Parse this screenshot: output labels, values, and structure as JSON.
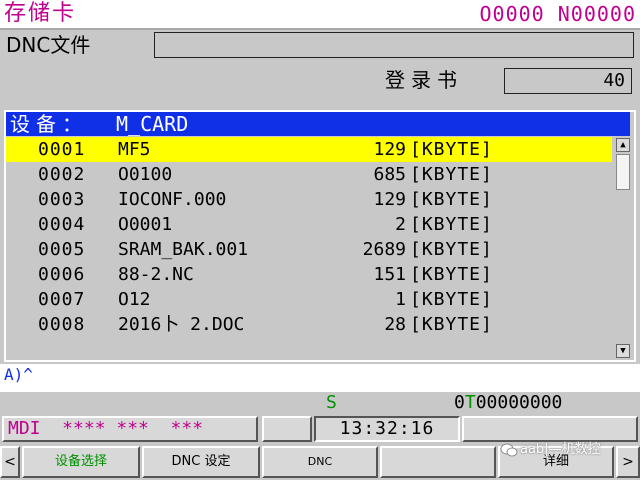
{
  "header": {
    "title": "存储卡",
    "program": "O0000 N00000"
  },
  "dnc": {
    "label": "DNC文件",
    "value": ""
  },
  "login": {
    "label": "登录书",
    "value": "40"
  },
  "list": {
    "device_label": "设备：",
    "device_value": "M_CARD",
    "rows": [
      {
        "no": "0001",
        "name": "MF5",
        "size": "129",
        "unit": "[KBYTE]",
        "selected": true
      },
      {
        "no": "0002",
        "name": "O0100",
        "size": "685",
        "unit": "[KBYTE]"
      },
      {
        "no": "0003",
        "name": "IOCONF.000",
        "size": "129",
        "unit": "[KBYTE]"
      },
      {
        "no": "0004",
        "name": "O0001",
        "size": "2",
        "unit": "[KBYTE]"
      },
      {
        "no": "0005",
        "name": "SRAM_BAK.001",
        "size": "2689",
        "unit": "[KBYTE]"
      },
      {
        "no": "0006",
        "name": "88-2.NC",
        "size": "151",
        "unit": "[KBYTE]"
      },
      {
        "no": "0007",
        "name": "O12",
        "size": "1",
        "unit": "[KBYTE]"
      },
      {
        "no": "0008",
        "name": "2016卜 2.DOC",
        "size": "28",
        "unit": "[KBYTE]"
      }
    ]
  },
  "scrollbar": {
    "up_icon": "triangle-up-icon",
    "down_icon": "triangle-down-icon"
  },
  "input_line": "A)^",
  "status": {
    "s_label": "S",
    "s_value_prefix": "0",
    "t_label": "T",
    "t_value": "00000000",
    "mode": "MDI  **** ***  ***",
    "clock": "13:32:16"
  },
  "softkeys": {
    "left": "<",
    "k1": "设备选择",
    "k2": "DNC 设定",
    "k3": "DNC",
    "k4": "",
    "k5": "详细",
    "right": ">"
  },
  "watermark": "aab|—机数控",
  "colors": {
    "header_text": "#c0008e",
    "panel_bg": "#c8c8c8",
    "list_header_bg": "#1030e8",
    "selection_bg": "#ffff00",
    "status_green": "#009000"
  }
}
